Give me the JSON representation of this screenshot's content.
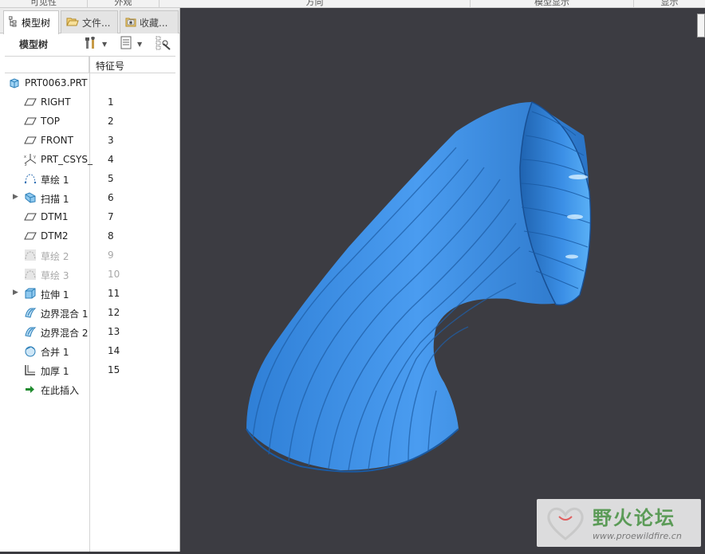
{
  "topbar": {
    "segments": [
      "可见性",
      "外观",
      "方向",
      "模型显示",
      "显示"
    ]
  },
  "tabs": [
    {
      "label": "模型树",
      "icon": "tree-icon",
      "active": true
    },
    {
      "label": "文件...",
      "icon": "folder-icon",
      "active": false
    },
    {
      "label": "收藏...",
      "icon": "favorites-icon",
      "active": false
    }
  ],
  "toolbar": {
    "label": "模型树"
  },
  "columns": {
    "feature_id": "特征号"
  },
  "tree": {
    "root": "PRT0063.PRT",
    "items": [
      {
        "name": "RIGHT",
        "num": "1",
        "icon": "datum-plane-icon"
      },
      {
        "name": "TOP",
        "num": "2",
        "icon": "datum-plane-icon"
      },
      {
        "name": "FRONT",
        "num": "3",
        "icon": "datum-plane-icon"
      },
      {
        "name": "PRT_CSYS_",
        "num": "4",
        "icon": "csys-icon"
      },
      {
        "name": "草绘 1",
        "num": "5",
        "icon": "sketch-icon"
      },
      {
        "name": "扫描 1",
        "num": "6",
        "icon": "sweep-icon"
      },
      {
        "name": "DTM1",
        "num": "7",
        "icon": "datum-plane-icon"
      },
      {
        "name": "DTM2",
        "num": "8",
        "icon": "datum-plane-icon"
      },
      {
        "name": "草绘 2",
        "num": "9",
        "icon": "sketch-hidden-icon"
      },
      {
        "name": "草绘 3",
        "num": "10",
        "icon": "sketch-hidden-icon"
      },
      {
        "name": "拉伸 1",
        "num": "11",
        "icon": "extrude-icon"
      },
      {
        "name": "边界混合 1",
        "num": "12",
        "icon": "boundary-blend-icon"
      },
      {
        "name": "边界混合 2",
        "num": "13",
        "icon": "boundary-blend-icon"
      },
      {
        "name": "合并 1",
        "num": "14",
        "icon": "merge-icon"
      },
      {
        "name": "加厚 1",
        "num": "15",
        "icon": "thicken-icon"
      },
      {
        "name": "在此插入",
        "num": "",
        "icon": "insert-here-icon"
      }
    ]
  },
  "watermark": {
    "title": "野火论坛",
    "url": "www.proewildfire.cn"
  },
  "colors": {
    "model_blue": "#3d8ee6",
    "viewport_bg": "#3c3c42"
  }
}
